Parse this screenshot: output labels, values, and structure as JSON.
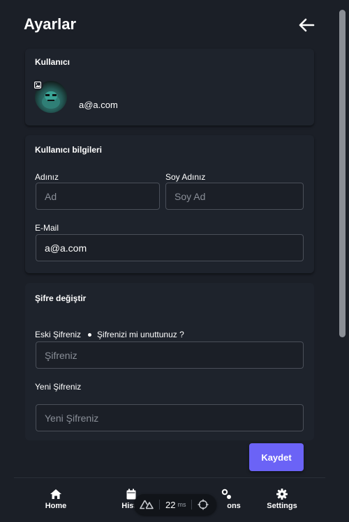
{
  "header": {
    "title": "Ayarlar"
  },
  "user_card": {
    "title": "Kullanıcı",
    "email": "a@a.com"
  },
  "info_card": {
    "title": "Kullanıcı bilgileri",
    "first_name_label": "Adınız",
    "first_name_placeholder": "Ad",
    "last_name_label": "Soy Adınız",
    "last_name_placeholder": "Soy Ad",
    "email_label": "E-Mail",
    "email_value": "a@a.com"
  },
  "password_card": {
    "title": "Şifre değiştir",
    "old_password_label": "Eski Şifreniz",
    "forgot_link": "Şifrenizi mi unuttunuz ?",
    "old_password_placeholder": "Şifreniz",
    "new_password_label": "Yeni Şifreniz",
    "new_password_placeholder": "Yeni Şifreniz"
  },
  "actions": {
    "save_label": "Kaydet"
  },
  "colors": {
    "background": "#1b1f27",
    "card": "#1e232c",
    "accent": "#6b63f6",
    "border": "#4a4f59"
  },
  "bottom_nav": [
    {
      "label": "Home",
      "icon": "home-icon"
    },
    {
      "label": "Histo",
      "icon": "calendar-icon"
    },
    {
      "label": "ons",
      "icon": "options-icon"
    },
    {
      "label": "Settings",
      "icon": "gear-icon"
    }
  ],
  "devtools": {
    "ms_value": "22",
    "ms_unit": "ms"
  }
}
